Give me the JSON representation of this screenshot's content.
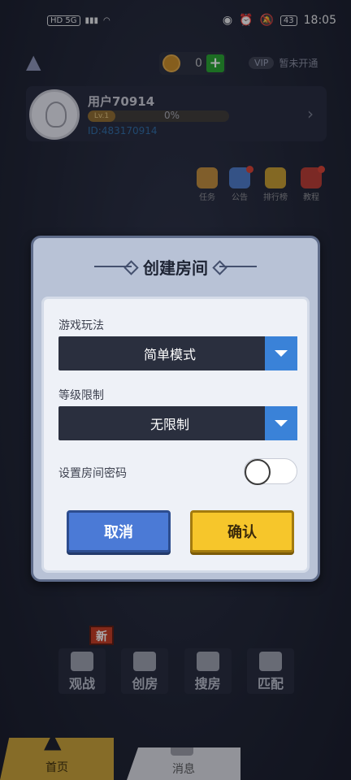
{
  "statusbar": {
    "left": "HD 5G",
    "battery": "43",
    "time": "18:05"
  },
  "topbar": {
    "coins": "0",
    "vip_badge": "VIP",
    "vip_status": "暂未开通"
  },
  "profile": {
    "username": "用户70914",
    "level": "Lv.1",
    "progress_label": "0%",
    "progress": 0,
    "user_id": "ID:483170914"
  },
  "quick_menu": {
    "items": [
      {
        "label": "任务",
        "icon": "task-icon"
      },
      {
        "label": "公告",
        "icon": "megaphone-icon"
      },
      {
        "label": "排行榜",
        "icon": "trophy-icon"
      },
      {
        "label": "教程",
        "icon": "tutorial-icon"
      }
    ]
  },
  "dialog": {
    "title": "创建房间",
    "mode_label": "游戏玩法",
    "mode_value": "简单模式",
    "level_label": "等级限制",
    "level_value": "无限制",
    "password_label": "设置房间密码",
    "password_enabled": false,
    "cancel_label": "取消",
    "confirm_label": "确认"
  },
  "actions": {
    "new_badge": "新",
    "items": [
      {
        "label": "观战",
        "icon": "eye-icon"
      },
      {
        "label": "创房",
        "icon": "house-plus-icon"
      },
      {
        "label": "搜房",
        "icon": "search-icon"
      },
      {
        "label": "匹配",
        "icon": "person-icon"
      }
    ]
  },
  "tabbar": {
    "home": "首页",
    "messages": "消息"
  },
  "colors": {
    "accent_blue": "#3a82d8",
    "confirm_yellow": "#f6c62b",
    "cancel_blue": "#4b7ad6",
    "coin_plus_green": "#27a12c"
  }
}
